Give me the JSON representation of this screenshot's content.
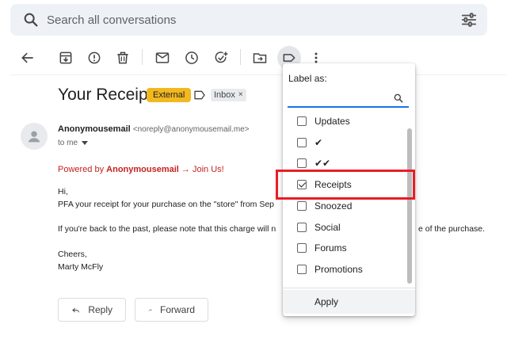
{
  "search": {
    "placeholder": "Search all conversations"
  },
  "message": {
    "subject": "Your Receipt",
    "badge": "External",
    "label_chip": "Inbox",
    "chip_close": "×",
    "sender_name": "Anonymousemail",
    "sender_email": "<noreply@anonymousemail.me>",
    "to": "to me",
    "powered_prefix": "Powered by ",
    "powered_brand": "Anonymousemail",
    "powered_suffix": " → Join Us!",
    "body": {
      "greeting": "Hi,",
      "line1": "PFA your receipt for your purchase on the \"store\" from Sep",
      "line2_start": "If you're back to the past, please note that this charge will n",
      "line2_end": "e of the purchase.",
      "closing": "Cheers,",
      "signature": "Marty McFly"
    }
  },
  "actions": {
    "reply": "Reply",
    "forward": "Forward"
  },
  "label_menu": {
    "title": "Label as:",
    "search_value": "",
    "items": [
      {
        "label": "Updates",
        "checked": false
      },
      {
        "label": "✔",
        "checked": false
      },
      {
        "label": "✔✔",
        "checked": false
      },
      {
        "label": "Receipts",
        "checked": true
      },
      {
        "label": "Snoozed",
        "checked": false
      },
      {
        "label": "Social",
        "checked": false
      },
      {
        "label": "Forums",
        "checked": false
      },
      {
        "label": "Promotions",
        "checked": false
      }
    ],
    "apply": "Apply"
  },
  "colors": {
    "badge": "#f2b81f",
    "powered": "#c5221f",
    "highlight": "#ea1d25",
    "focus": "#1a73e8"
  }
}
